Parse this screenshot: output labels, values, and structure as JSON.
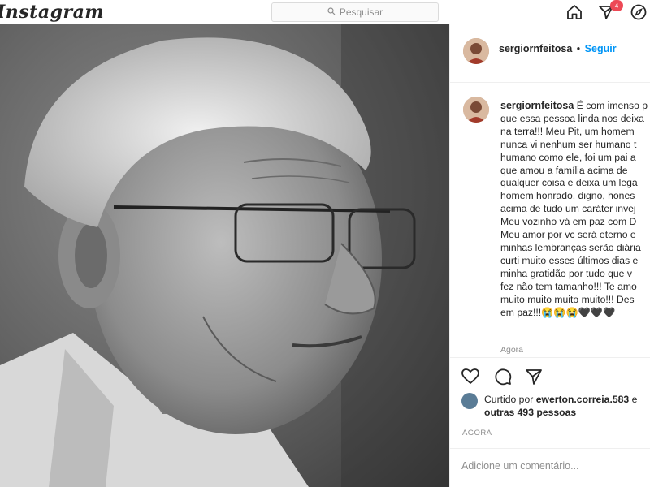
{
  "topbar": {
    "logo": "Instagram",
    "search_placeholder": "Pesquisar",
    "notification_count": "4"
  },
  "post": {
    "username": "sergiornfeitosa",
    "follow_label": "Seguir",
    "separator": "•",
    "caption_lines": [
      "É com imenso p",
      "que essa pessoa linda nos deixa",
      "na terra!!! Meu Pit, um homem",
      "nunca vi nenhum ser humano t",
      "humano como ele, foi um pai a",
      "que amou a família acima de",
      "qualquer coisa e deixa um lega",
      "homem honrado, digno, hones",
      "acima de tudo um caráter invej",
      "Meu vozinho vá em paz com D",
      "Meu amor por vc será eterno e",
      "minhas lembranças serão diária",
      "curti muito esses últimos dias e",
      "minha gratidão por tudo que v",
      "fez não tem tamanho!!! Te amo",
      "muito muito muito muito!!! Des",
      "em paz!!!😭😭😭🖤🖤🖤"
    ],
    "caption_time": "Agora",
    "likes_prefix": "Curtido por",
    "liker": "ewerton.correia.583",
    "likes_and": "e",
    "likes_others": "outras 493 pessoas",
    "post_time": "AGORA",
    "comment_placeholder": "Adicione um comentário..."
  },
  "icons": {
    "home": "home-icon",
    "direct": "direct-icon",
    "explore": "compass-icon",
    "like": "heart-icon",
    "comment": "comment-icon",
    "share": "share-icon"
  },
  "colors": {
    "follow": "#0095f6",
    "badge": "#ed4956",
    "border": "#dbdbdb"
  }
}
